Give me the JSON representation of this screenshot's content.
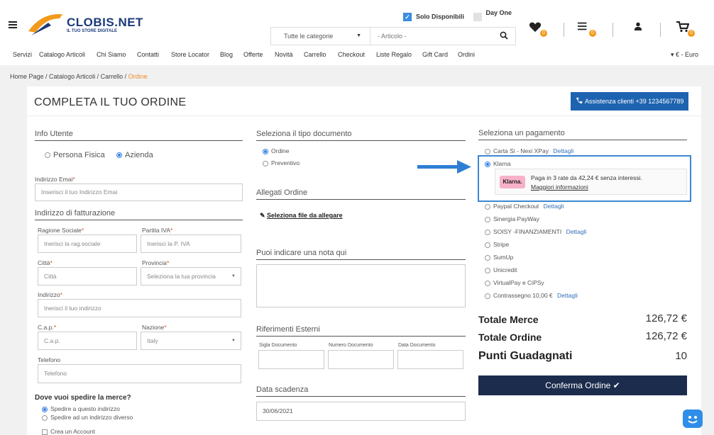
{
  "header": {
    "logo_name": "CLOBIS.NET",
    "logo_tagline": "IL TUO STORE DIGITALE",
    "solo_disponibili": "Solo Disponibili",
    "day_one": "Day One",
    "category_select": "Tutte le categorie",
    "search_placeholder": "- Articolo -",
    "wishlist_count": "0",
    "compare_count": "0",
    "cart_count": "0"
  },
  "nav": {
    "items": [
      "Servizi",
      "Catalogo Articoli",
      "Chi Siamo",
      "Contatti",
      "Store Locator",
      "Blog",
      "Offerte",
      "Novità",
      "Carrello",
      "Checkout",
      "Liste Regalo",
      "Gift Card",
      "Ordini"
    ],
    "currency": "▾ € - Euro"
  },
  "breadcrumb": {
    "home": "Home Page",
    "catalog": "Catalogo Articoli",
    "cart": "Carrello",
    "current": "Ordine"
  },
  "page": {
    "title": "COMPLETA IL TUO ORDINE",
    "assist_button": "Assistenza clienti +39 1234567789"
  },
  "user": {
    "section": "Info Utente",
    "type_private": "Persona Fisica",
    "type_company": "Azienda",
    "email_label": "Indirizzo Emai",
    "email_placeholder": "Inserisci il tuo Indirizzo Emai",
    "billing_section": "Indirizzo di fatturazione",
    "company_label": "Ragione Sociale",
    "company_placeholder": "Inerisci la rag.sociale",
    "vat_label": "Partita IVA",
    "vat_placeholder": "Inerisci la P. IVA",
    "city_label": "Città",
    "city_placeholder": "Città",
    "province_label": "Provincia",
    "province_value": "Seleziona la tua provincia",
    "address_label": "Indirizzo",
    "address_placeholder": "Inerisci il tuo indirizzo",
    "zip_label": "C.a.p.",
    "zip_placeholder": "C.a.p.",
    "country_label": "Nazione",
    "country_value": "Italy",
    "phone_label": "Telefono",
    "phone_placeholder": "Telefono",
    "ship_question": "Dove vuoi spedire la merce?",
    "ship_same": "Spedire a questo indirizzo",
    "ship_other": "Spedire ad un indirizzo diverso",
    "create_account": "Crea un Account"
  },
  "document": {
    "section": "Seleziona il tipo documento",
    "order": "Ordine",
    "quote": "Preventivo",
    "attach_section": "Allegati Ordine",
    "attach_link": "Seleziona file da allegare",
    "note_section": "Puoi indicare una nota qui",
    "ext_section": "Riferimenti Esterni",
    "doc_sigla": "Sigla Documento",
    "doc_number": "Numero Documento",
    "doc_date": "Data Documento",
    "due_section": "Data scadenza",
    "due_value": "30/06/2021"
  },
  "payment": {
    "section": "Seleziona un pagamento",
    "details": "Dettagli",
    "options": [
      "Carta Si - Nexi XPay",
      "Klarna",
      "Paypal Checkout",
      "Sinergia PayWay",
      "SOISY -FINANZIAMENTI",
      "Stripe",
      "SumUp",
      "Unicredit",
      "VirtualPay e CiPSy",
      "Contrassegno 10,00 €"
    ],
    "klarna_logo": "Klarna.",
    "klarna_text": "Paga in 3 rate da 42,24 € senza interessi.",
    "klarna_more": "Maggiori informazioni"
  },
  "totals": {
    "goods_label": "Totale Merce",
    "goods_value": "126,72 €",
    "order_label": "Totale Ordine",
    "order_value": "126,72 €",
    "points_label": "Punti Guadagnati",
    "points_value": "10",
    "confirm": "Confermа Ordine ✔"
  },
  "colors": {
    "accent": "#1e63b0",
    "orange": "#f29a1c",
    "confirm": "#1c2c4d",
    "highlight": "#3c87d2"
  }
}
